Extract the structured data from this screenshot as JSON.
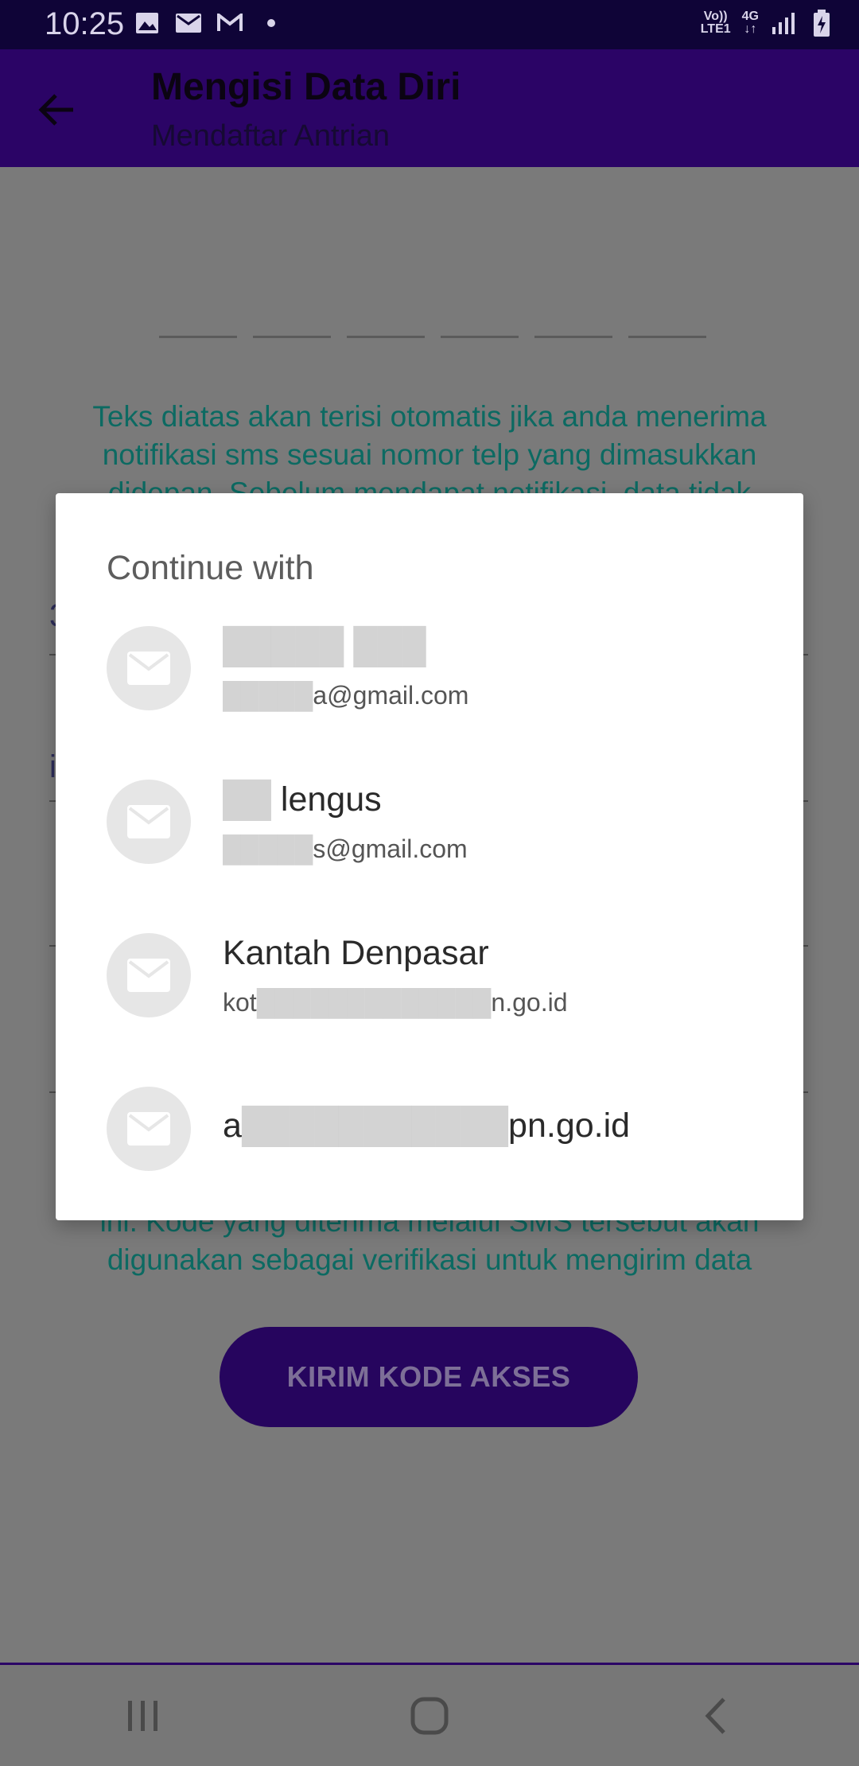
{
  "status_bar": {
    "time": "10:25",
    "network_top": "Vo))",
    "network_bottom": "LTE1",
    "network_type": "4G"
  },
  "app_bar": {
    "title": "Mengisi Data Diri",
    "subtitle": "Mendaftar Antrian"
  },
  "background": {
    "info_top": "Teks diatas akan terisi otomatis jika anda menerima notifikasi sms sesuai nomor telp yang dimasukkan didepan. Sebelum mendapat notifikasi, data tidak",
    "field_fragment_1": "3",
    "field_fragment_2": "i",
    "info_bottom": "ini. Kode yang diterima melalui SMS tersebut akan digunakan sebagai verifikasi untuk mengirim data",
    "kirim_button": "KIRIM KODE AKSES"
  },
  "dialog": {
    "title": "Continue with",
    "accounts": [
      {
        "name_visible": "",
        "email_visible": "a@gmail.com"
      },
      {
        "name_visible": "lengus",
        "email_visible": "s@gmail.com"
      },
      {
        "name_visible": "Kantah Denpasar",
        "email_visible": "n.go.id",
        "email_prefix": "kot"
      },
      {
        "email_single": "pn.go.id",
        "email_prefix": "a"
      }
    ]
  },
  "colors": {
    "app_bar": "#2b0466",
    "status_bar": "#0f0437",
    "accent_text": "#0c6a62",
    "scrim": "#7a7a7a"
  },
  "icons": {
    "back": "arrow-left-icon",
    "account": "mail-icon",
    "nav": [
      "recents-icon",
      "home-icon",
      "back-nav-icon"
    ]
  }
}
